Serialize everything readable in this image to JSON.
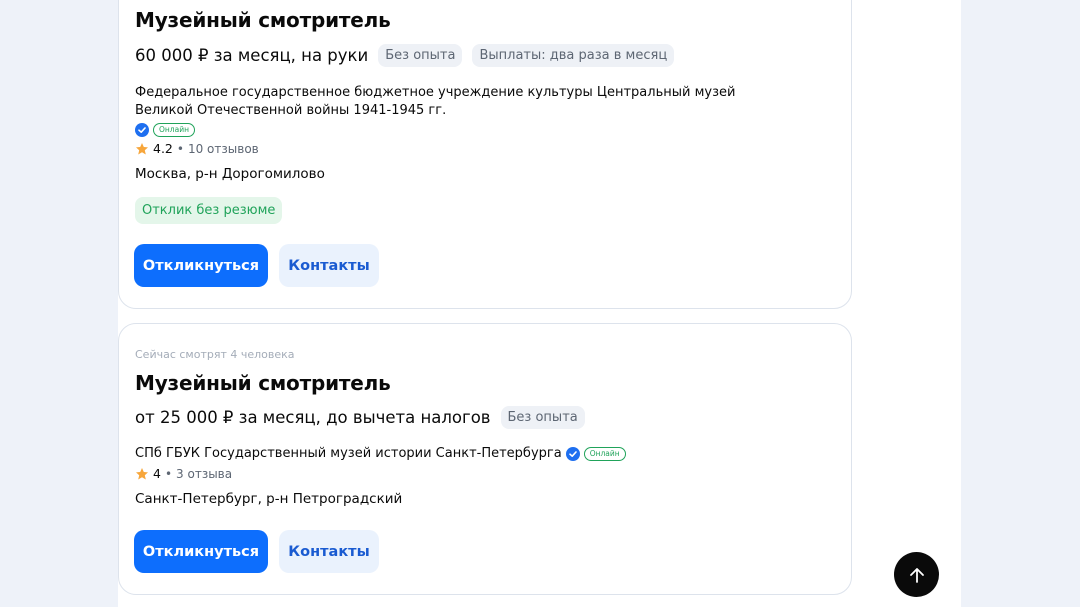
{
  "vacancies": [
    {
      "title": "Музейный смотритель",
      "salary": "60 000 ₽ за месяц, на руки",
      "tags": [
        "Без опыта",
        "Выплаты: два раза в месяц"
      ],
      "company": "Федеральное государственное бюджетное учреждение культуры Центральный музей Великой Отечественной войны 1941-1945 гг.",
      "online_badge": "Онлайн",
      "rating": "4.2",
      "reviews": "10 отзывов",
      "location": "Москва, р-н Дорогомилово",
      "no_resume_tag": "Отклик без резюме",
      "apply_label": "Откликнуться",
      "contacts_label": "Контакты"
    },
    {
      "watchers": "Сейчас смотрят 4 человека",
      "title": "Музейный смотритель",
      "salary": "от 25 000 ₽ за месяц, до вычета налогов",
      "tags": [
        "Без опыта"
      ],
      "company": "СПб ГБУК Государственный музей истории Санкт-Петербурга",
      "online_badge": "Онлайн",
      "rating": "4",
      "reviews": "3 отзыва",
      "location": "Санкт-Петербург, р-н Петроградский",
      "apply_label": "Откликнуться",
      "contacts_label": "Контакты"
    }
  ],
  "scroll_top_icon": "arrow-up-icon",
  "colors": {
    "primary": "#0d6efd",
    "background": "#eef2f9",
    "green": "#20a35a",
    "star": "#f7a63b"
  }
}
